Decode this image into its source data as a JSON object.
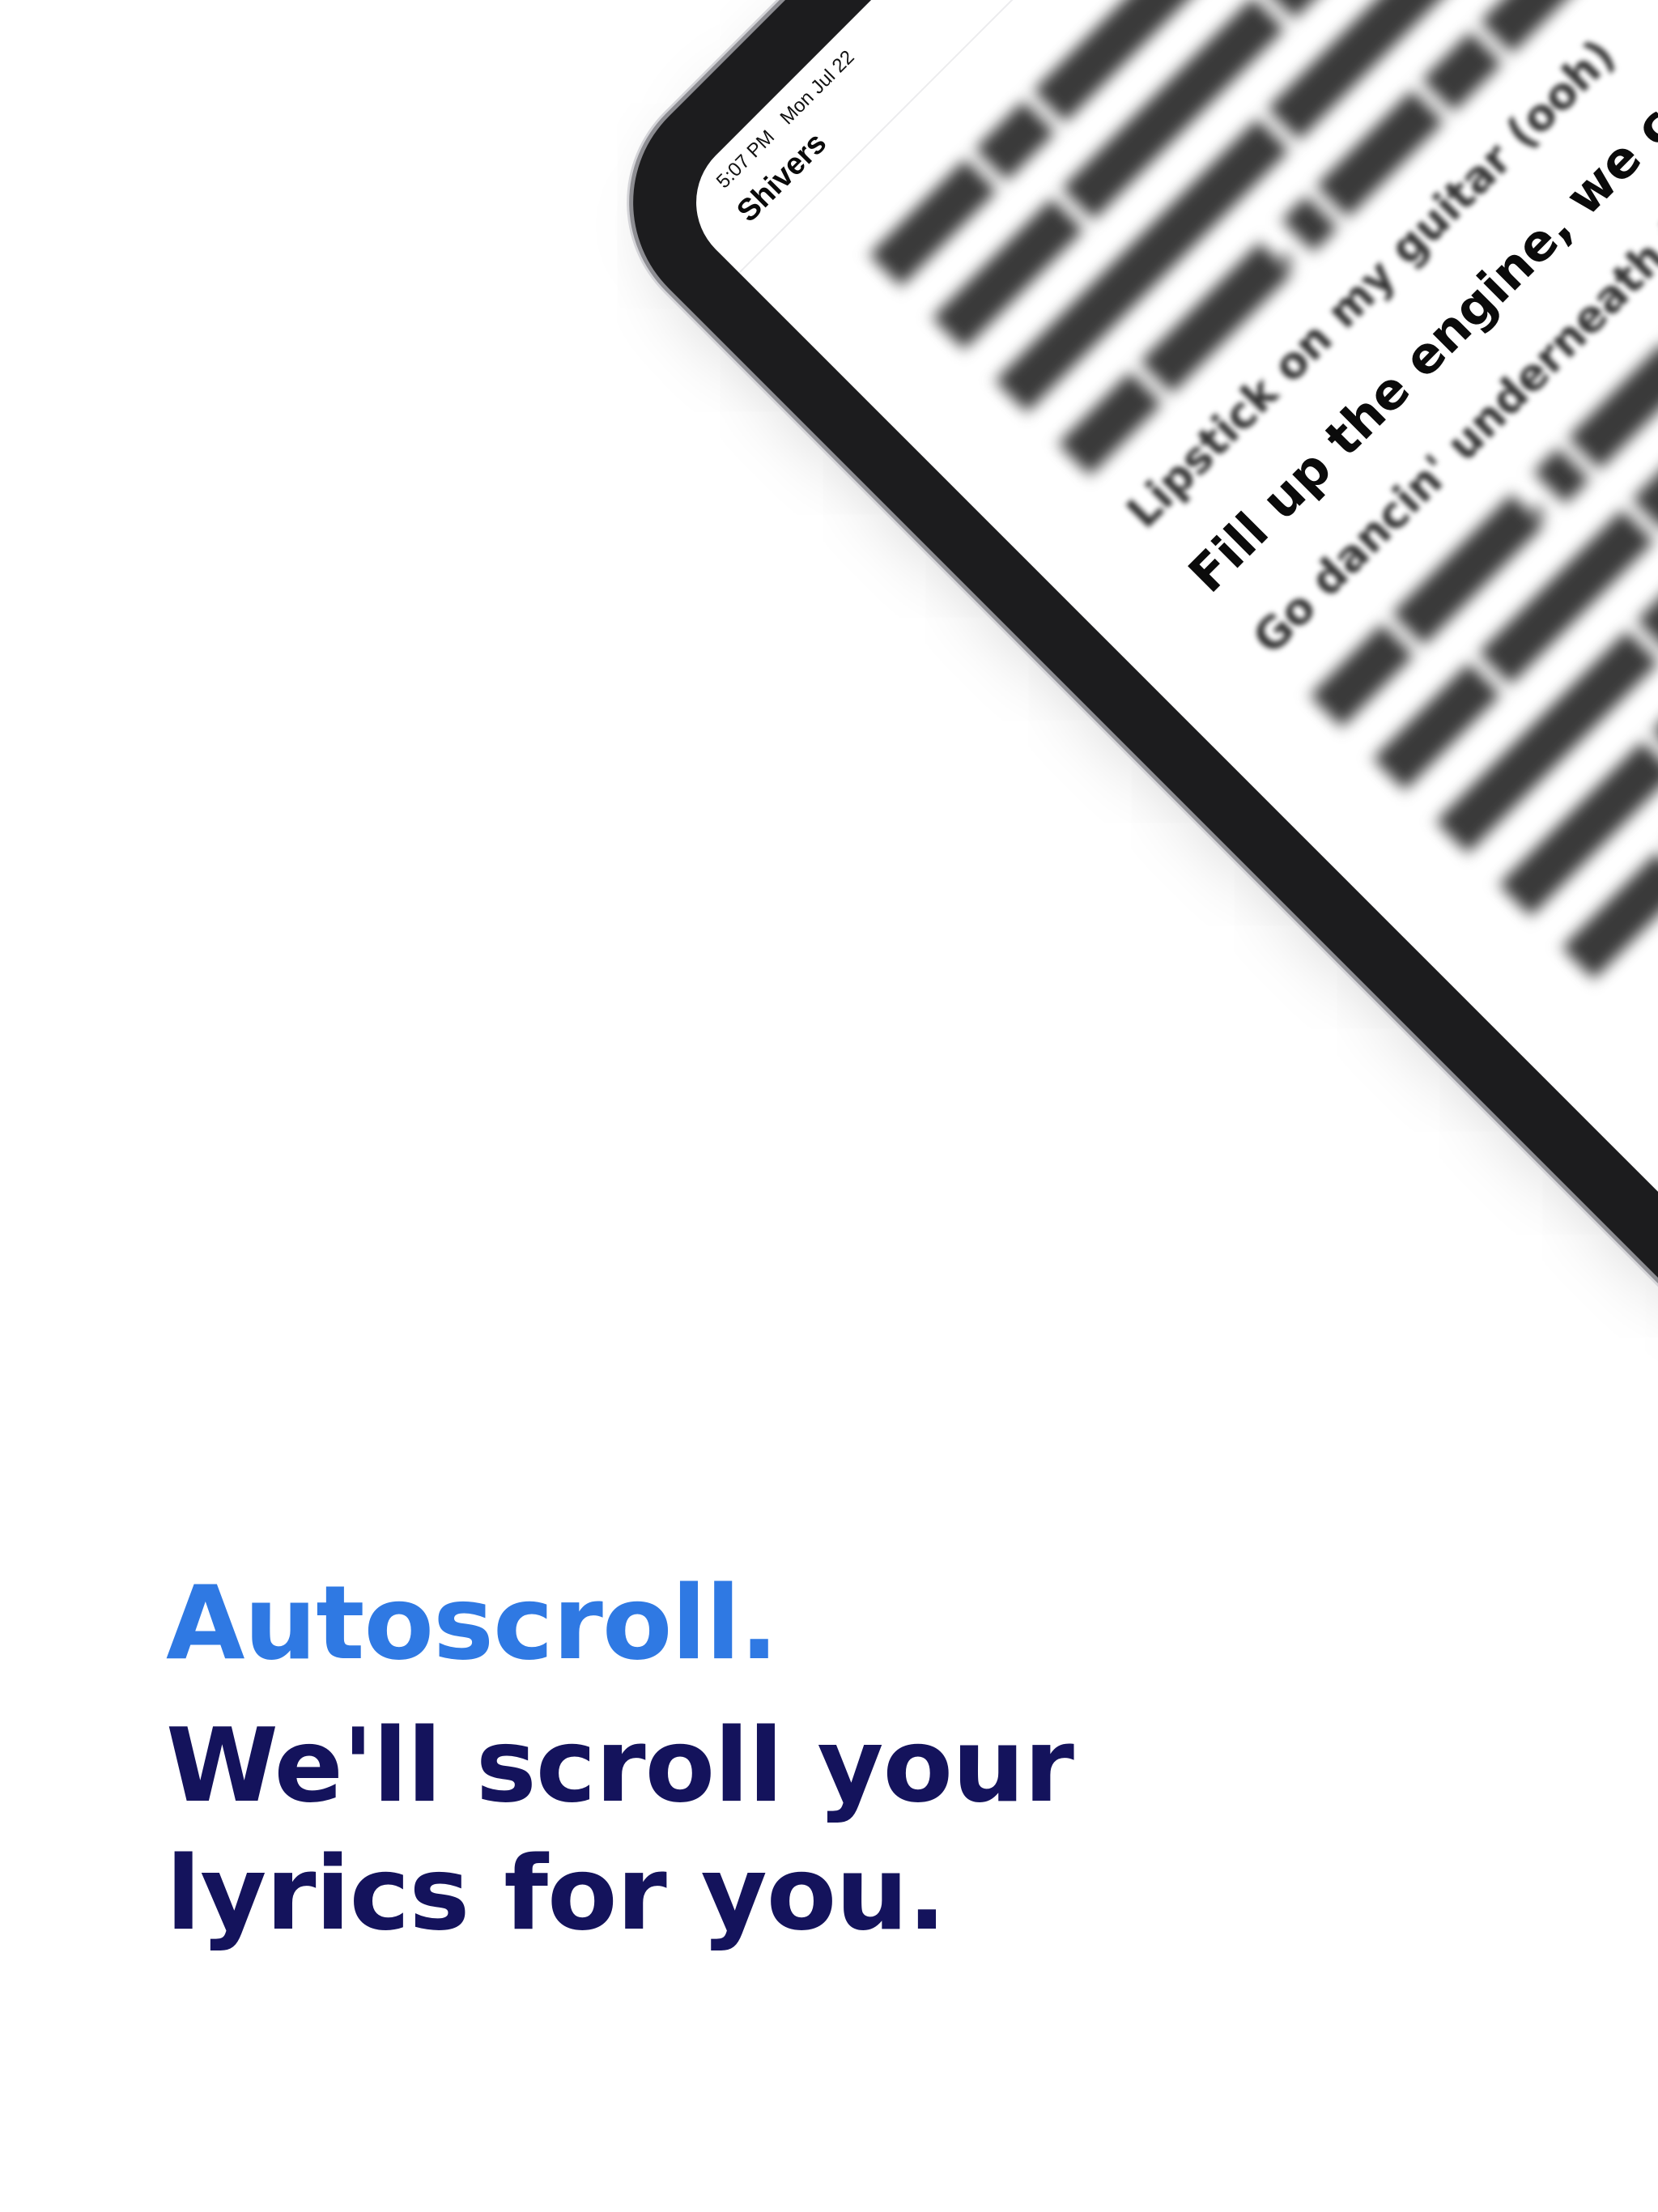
{
  "headline": {
    "accent": "Autoscroll.",
    "line1": "We'll scroll your",
    "line2": "lyrics for you."
  },
  "device": {
    "status_bar": {
      "time": "5:07 PM",
      "date": "Mon Jul 22"
    },
    "nav": {
      "song_title": "Shivers",
      "edit_icon": "pencil-icon"
    },
    "lyrics": {
      "visible_lines": [
        "Lipstick on my guitar (ooh)",
        "Fill up the engine, we can drive",
        "Go dancin' underneath the"
      ],
      "current_line_index": 1
    }
  },
  "colors": {
    "accent": "#2f79e3",
    "headline": "#14135c",
    "button": "#1a7ef3",
    "bezel": "#1c1c1e",
    "background": "#ffffff"
  }
}
